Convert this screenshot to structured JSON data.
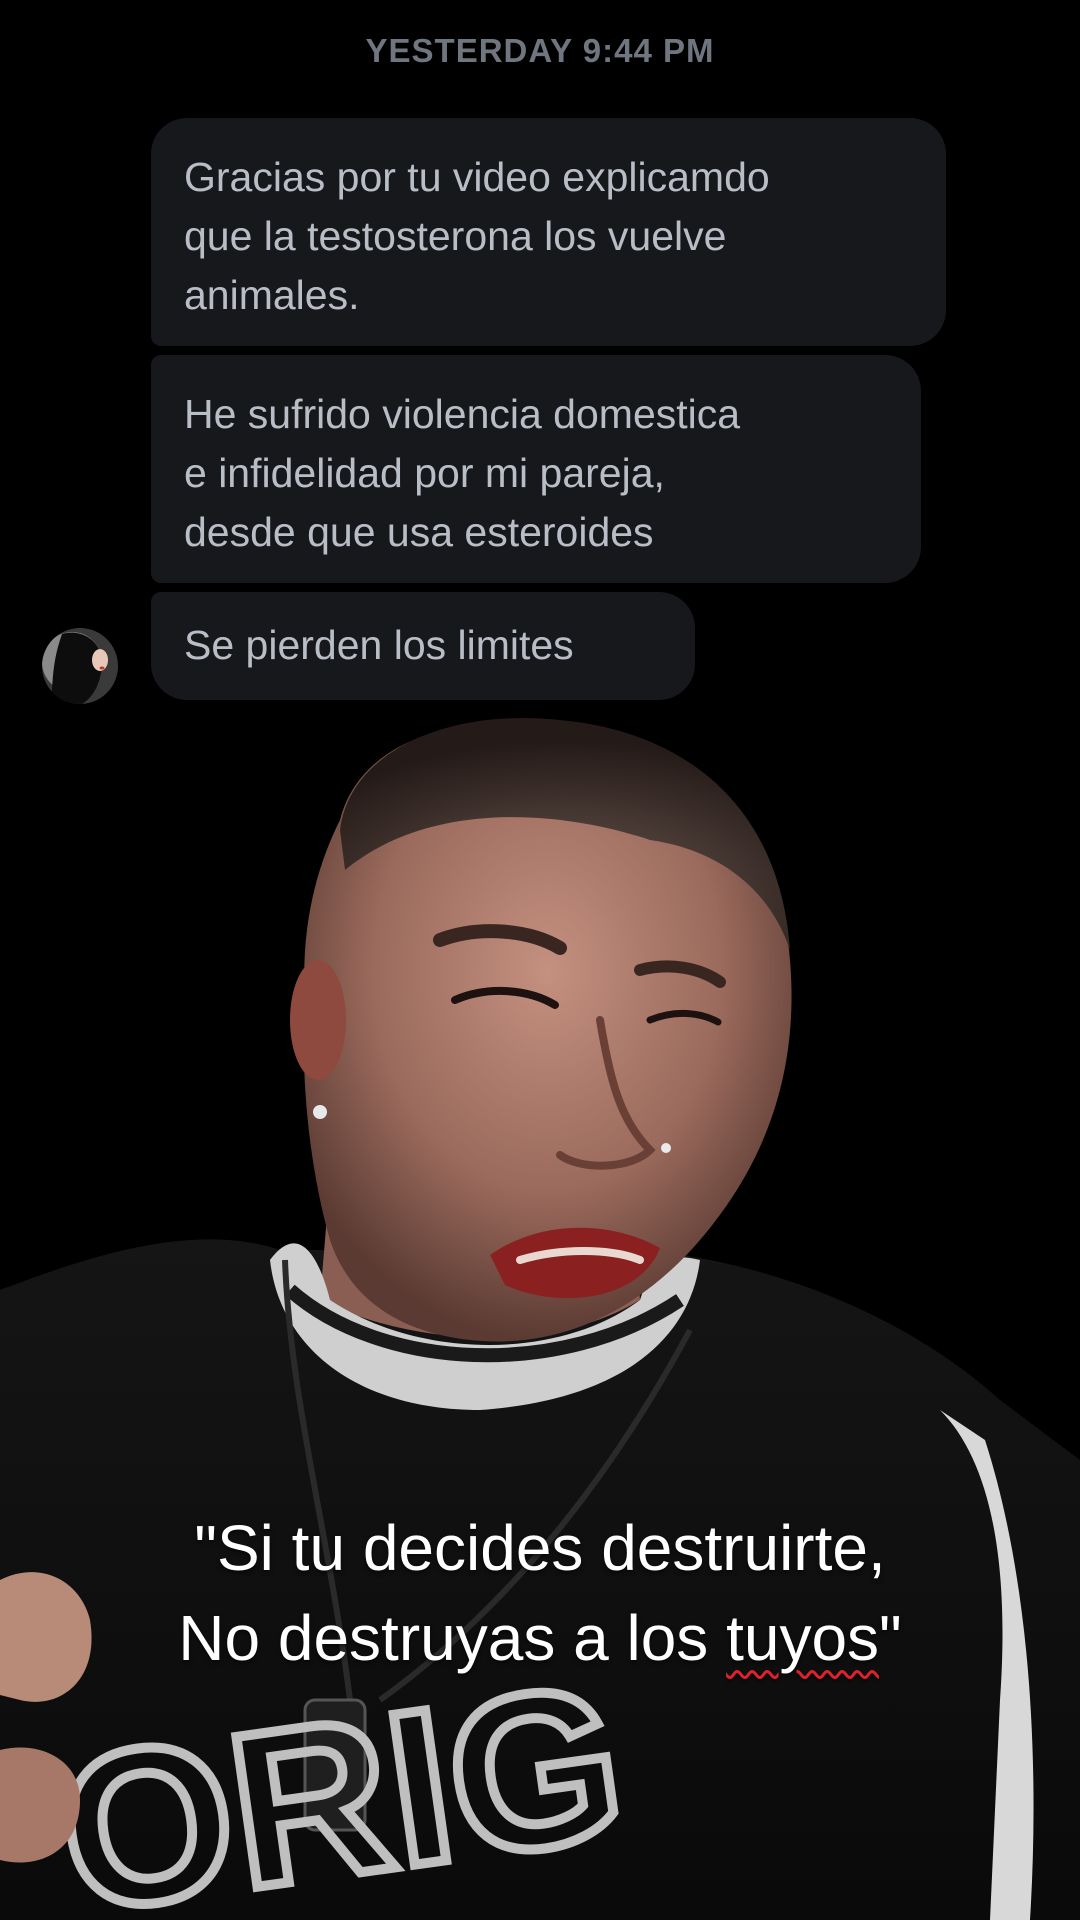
{
  "timestamp": "YESTERDAY 9:44 PM",
  "messages": [
    {
      "text": "Gracias por tu video explicamdo\nque la testosterona los vuelve\nanimales."
    },
    {
      "text": "He sufrido violencia domestica\ne infidelidad por mi pareja,\ndesde que usa esteroides"
    },
    {
      "text": "Se pierden los limites"
    }
  ],
  "caption": {
    "line1": "\"Si tu decides destruirte,",
    "line2_start": "No destruyas a los ",
    "line2_underlined": "tuyos",
    "line2_end": "\""
  },
  "colors": {
    "background": "#000000",
    "bubble": "#17181c",
    "bubble_text": "#b9bec6",
    "timestamp": "#6f7680",
    "caption": "#ffffff",
    "spellcheck_underline": "#e0202a"
  }
}
